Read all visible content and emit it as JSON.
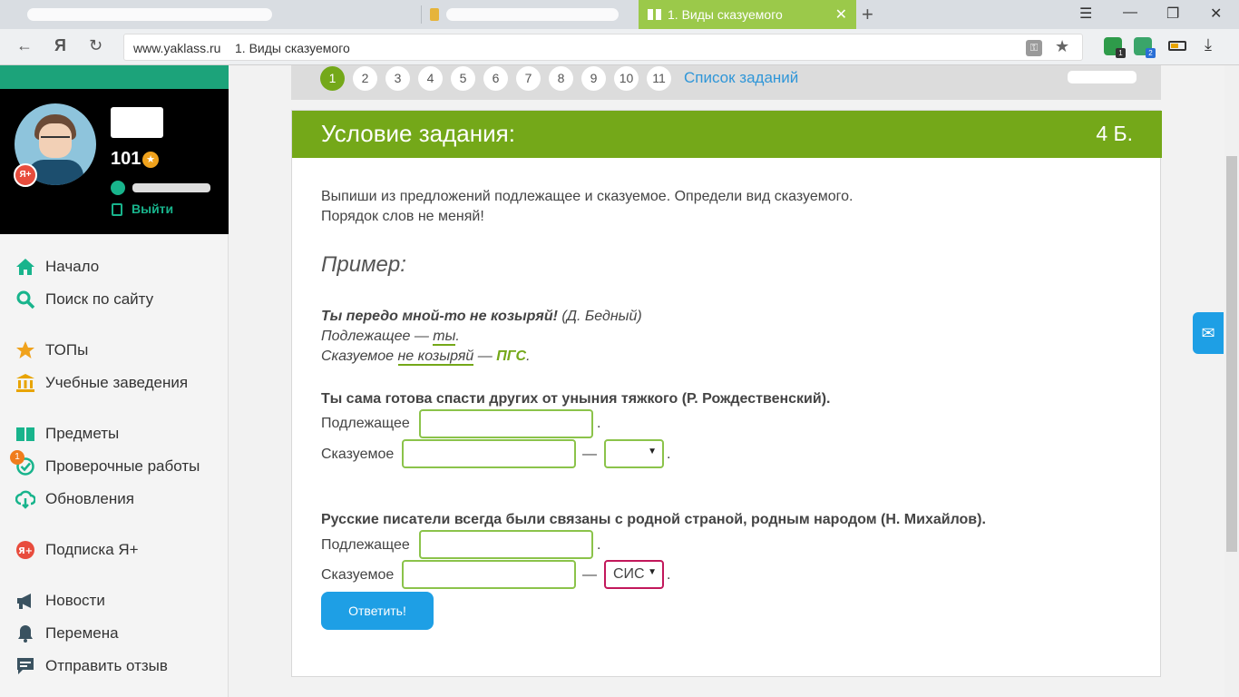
{
  "browser": {
    "active_tab_title": "1. Виды сказуемого",
    "url_domain": "www.yaklass.ru",
    "url_page": "1. Виды сказуемого",
    "ext_badges": [
      "1",
      "2"
    ]
  },
  "profile": {
    "points": "101",
    "logout_label": "Выйти"
  },
  "menu": [
    {
      "label": "Начало"
    },
    {
      "label": "Поиск по сайту"
    },
    {
      "label": "ТОПы"
    },
    {
      "label": "Учебные заведения"
    },
    {
      "label": "Предметы"
    },
    {
      "label": "Проверочные работы",
      "badge": "1"
    },
    {
      "label": "Обновления"
    },
    {
      "label": "Подписка Я+"
    },
    {
      "label": "Новости"
    },
    {
      "label": "Перемена"
    },
    {
      "label": "Отправить отзыв"
    }
  ],
  "pager": {
    "pages": [
      "1",
      "2",
      "3",
      "4",
      "5",
      "6",
      "7",
      "8",
      "9",
      "10",
      "11"
    ],
    "active_page": "1",
    "list_link": "Список заданий"
  },
  "task": {
    "header": "Условие задания:",
    "score": "4 Б.",
    "instruction_1": "Выпиши из предложений подлежащее и сказуемое. Определи вид сказуемого.",
    "instruction_2": "Порядок слов не меняй!",
    "example_heading": "Пример:",
    "example": {
      "sentence": "Ты передо мной-то не козыряй!",
      "author": "(Д. Бедный)",
      "subject_label": "Подлежащее —",
      "subject_answer": "ты",
      "predicate_label": "Сказуемое",
      "predicate_answer": "не козыряй",
      "dash": "—",
      "type_answer": "ПГС",
      "dot": "."
    },
    "questions": [
      {
        "sentence": "Ты сама готова спасти других от уныния тяжкого (Р. Рождественский).",
        "subject_label": "Подлежащее",
        "predicate_label": "Сказуемое",
        "subject_value": "",
        "predicate_value": "",
        "type_value": ""
      },
      {
        "sentence": "Русские писатели всегда были связаны с родной страной, родным народом (Н. Михайлов).",
        "subject_label": "Подлежащее",
        "predicate_label": "Сказуемое",
        "subject_value": "",
        "predicate_value": "",
        "type_value": "СИС"
      }
    ],
    "submit_label": "Ответить!"
  }
}
